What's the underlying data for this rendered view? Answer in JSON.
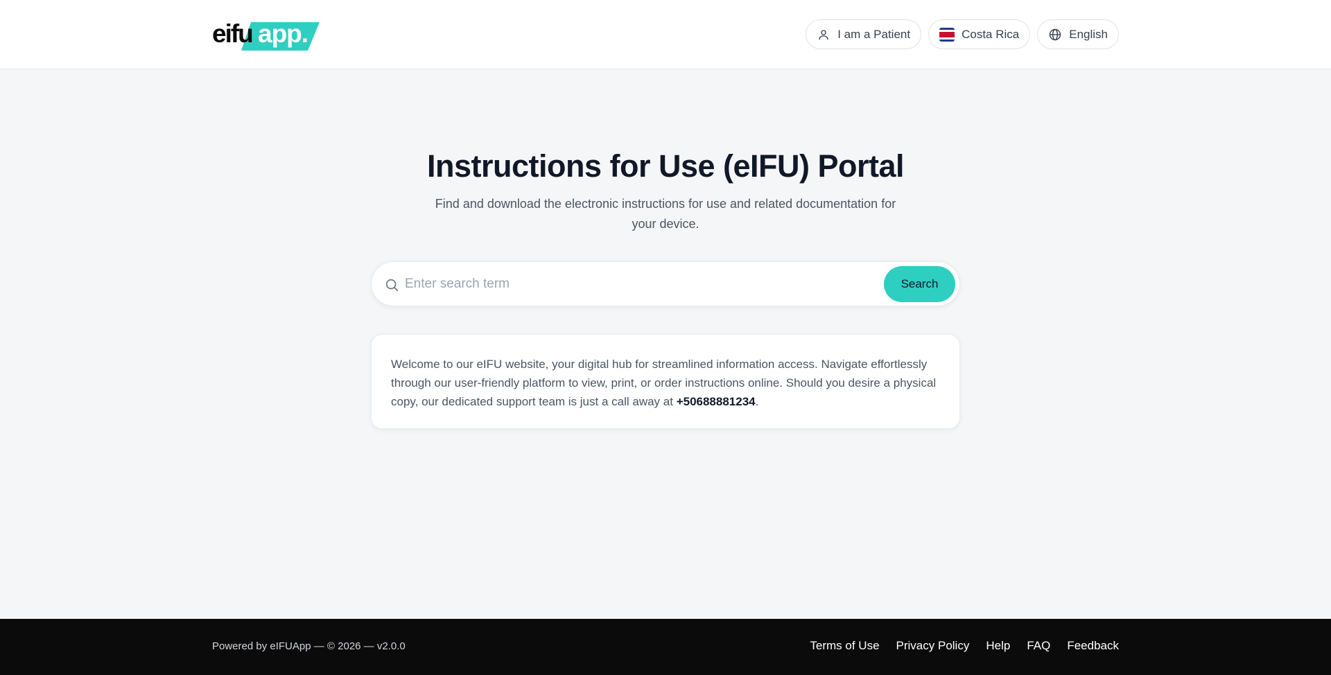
{
  "header": {
    "logo_text_dark": "eifu",
    "logo_text_light": "app.",
    "patient_label": "I am a Patient",
    "country_label": "Costa Rica",
    "language_label": "English"
  },
  "main": {
    "title": "Instructions for Use (eIFU) Portal",
    "subtitle": "Find and download the electronic instructions for use and related documentation for your device.",
    "search": {
      "placeholder": "Enter search term",
      "button_label": "Search"
    },
    "welcome": {
      "text_before": "Welcome to our eIFU website, your digital hub for streamlined information access. Navigate effortlessly through our user-friendly platform to view, print, or order instructions online. Should you desire a physical copy, our dedicated support team is just a call away at ",
      "phone": "+50688881234",
      "text_after": "."
    }
  },
  "footer": {
    "powered": "Powered by eIFUApp — © 2026 — v2.0.0",
    "links": [
      "Terms of Use",
      "Privacy Policy",
      "Help",
      "FAQ",
      "Feedback"
    ]
  },
  "colors": {
    "accent": "#2ecfc0",
    "background": "#f4f6f8",
    "footer_bg": "#0b0b0c"
  },
  "icons": {
    "patient": "user-icon",
    "country": "costa-rica-flag-icon",
    "language": "globe-icon",
    "search": "search-icon"
  }
}
